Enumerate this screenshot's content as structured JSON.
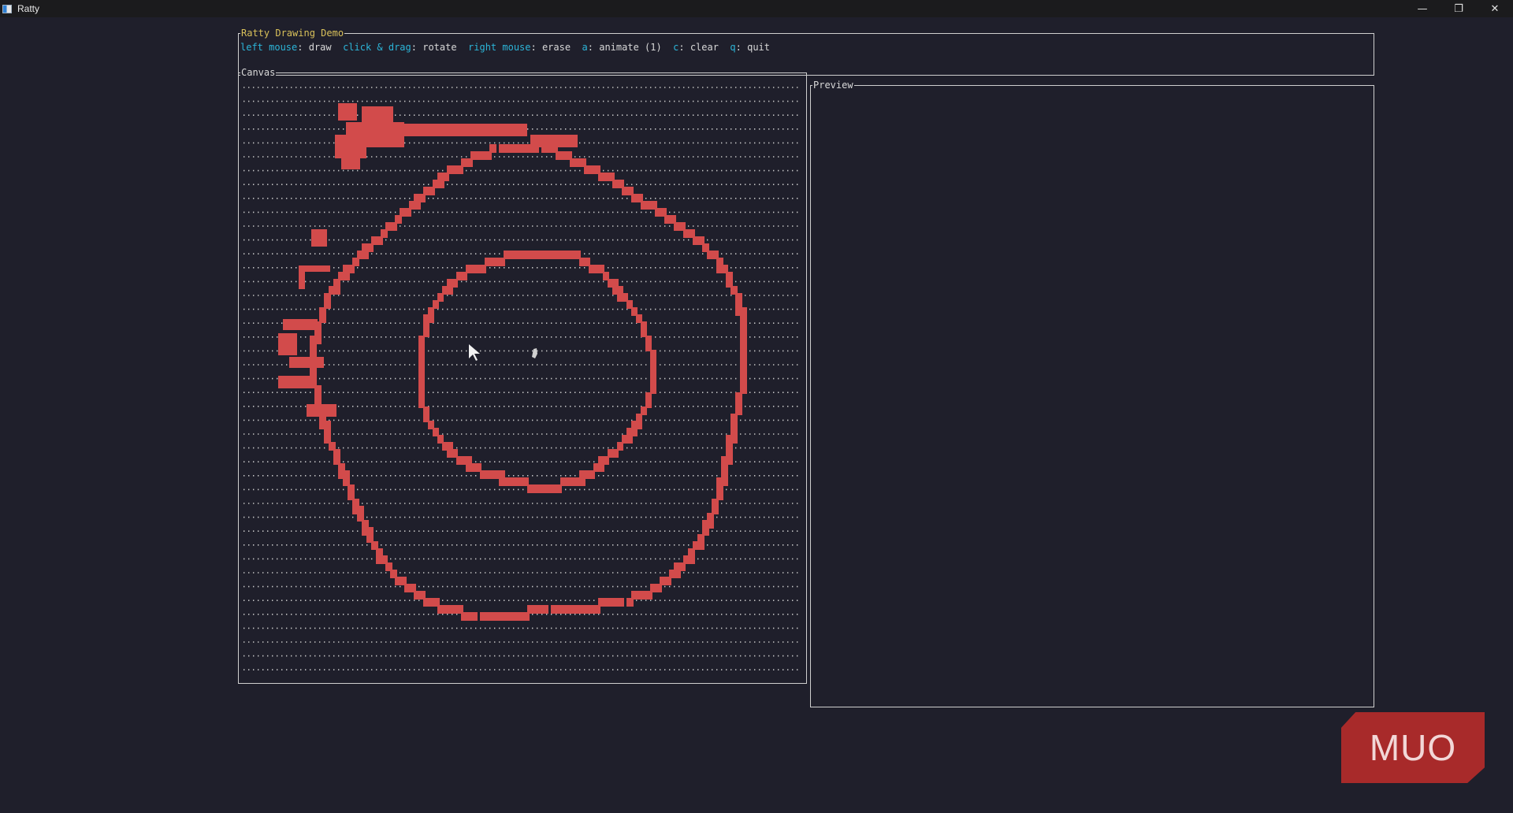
{
  "window": {
    "title": "Ratty",
    "minimize_icon": "minimize-icon",
    "maximize_icon": "restore-icon",
    "close_icon": "close-icon"
  },
  "header": {
    "title": "Ratty Drawing Demo",
    "help": [
      {
        "key": "left mouse",
        "desc": ": draw"
      },
      {
        "key": "click & drag",
        "desc": ": rotate"
      },
      {
        "key": "right mouse",
        "desc": ": erase"
      },
      {
        "key": "a",
        "desc": ": animate (1)"
      },
      {
        "key": "c",
        "desc": ": clear"
      },
      {
        "key": "q",
        "desc": ": quit"
      }
    ]
  },
  "canvas": {
    "title": "Canvas",
    "stroke_color": "#d24b4b",
    "dot_color": "#c8c8c8"
  },
  "preview": {
    "title": "Preview"
  },
  "watermark": {
    "text": "MUO",
    "color": "#a82a2a"
  }
}
